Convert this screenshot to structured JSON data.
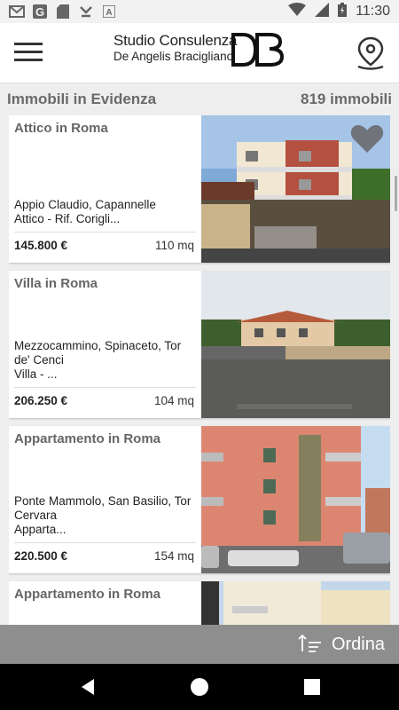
{
  "status_bar": {
    "time": "11:30",
    "icons": [
      "gmail-icon",
      "google-icon",
      "sd-card-icon",
      "download-icon",
      "a-icon",
      "wifi-icon",
      "signal-icon",
      "battery-icon"
    ]
  },
  "app_bar": {
    "logo_line1": "Studio Consulenza",
    "logo_line2": "De Angelis Bracigliano",
    "logo_mark": "DB"
  },
  "list_header": {
    "title": "Immobili in Evidenza",
    "count": "819 immobili"
  },
  "listings": [
    {
      "title": "Attico in Roma",
      "address": "Appio Claudio, Capannelle",
      "description": "Attico - Rif. Corigli...",
      "price": "145.800 €",
      "size": "110 mq",
      "favorite": true
    },
    {
      "title": "Villa in Roma",
      "address": "Mezzocammino, Spinaceto, Tor de' Cenci",
      "description": "Villa - ...",
      "price": "206.250 €",
      "size": "104 mq",
      "favorite": false
    },
    {
      "title": "Appartamento in Roma",
      "address": "Ponte Mammolo, San Basilio, Tor Cervara",
      "description": "Apparta...",
      "price": "220.500 €",
      "size": "154 mq",
      "favorite": false
    },
    {
      "title": "Appartamento in Roma",
      "address": "",
      "description": "",
      "price": "",
      "size": "",
      "favorite": false
    }
  ],
  "bottom_bar": {
    "sort_label": "Ordina"
  },
  "colors": {
    "accent_gray": "#8e8e8e",
    "heart": "#666666"
  }
}
